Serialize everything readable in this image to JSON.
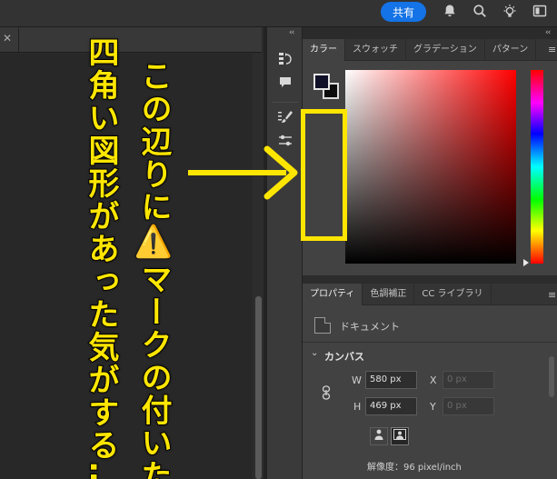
{
  "topbar": {
    "share_label": "共有",
    "icons": [
      "bell-icon",
      "search-icon",
      "lightbulb-icon",
      "workspace-icon"
    ]
  },
  "panel_collapse": "‹‹",
  "color_panel": {
    "tabs": [
      "カラー",
      "スウォッチ",
      "グラデーション",
      "パターン"
    ],
    "active_tab": "カラー",
    "foreground_color": "#101028",
    "background_color": "#0d0d0d",
    "picker_hue": "#ff0000"
  },
  "properties_panel": {
    "tabs": [
      "プロパティ",
      "色調補正",
      "CC ライブラリ"
    ],
    "active_tab": "プロパティ",
    "doc_label": "ドキュメント",
    "section_title": "カンバス",
    "width_label": "W",
    "width_value": "580 px",
    "height_label": "H",
    "height_value": "469 px",
    "x_label": "X",
    "x_placeholder": "0 px",
    "y_label": "Y",
    "y_placeholder": "0 px",
    "resolution": "解像度：96 pixel/inch"
  },
  "annotation": {
    "line1": "この辺りに⚠️マークの付いた",
    "line2": "四角い図形があった気がする…",
    "highlight_color": "#ffe600"
  }
}
